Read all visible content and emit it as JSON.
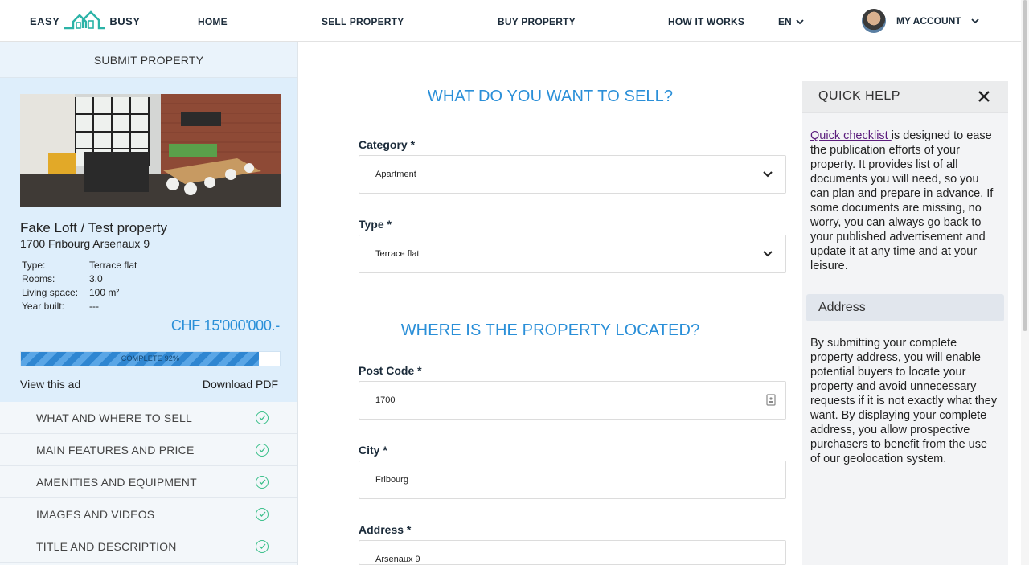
{
  "nav": {
    "logo_left": "EASY",
    "logo_right": "BUSY",
    "home": "HOME",
    "sell": "SELL PROPERTY",
    "buy": "BUY PROPERTY",
    "how": "HOW IT WORKS",
    "lang": "EN",
    "account": "MY ACCOUNT"
  },
  "sidebar": {
    "title": "SUBMIT PROPERTY",
    "property": {
      "name": "Fake Loft / Test property",
      "address": "1700 Fribourg Arsenaux 9",
      "specs": [
        {
          "label": "Type:",
          "value": "Terrace flat"
        },
        {
          "label": "Rooms:",
          "value": "3.0"
        },
        {
          "label": "Living space:",
          "value": "100 m²"
        },
        {
          "label": "Year built:",
          "value": "---"
        }
      ],
      "price": "CHF 15'000'000.-",
      "progress_text": "COMPLETE 92%",
      "progress_fraction": 0.92,
      "view_link": "View this ad",
      "pdf_link": "Download PDF"
    },
    "steps": [
      {
        "label": "WHAT AND WHERE TO SELL"
      },
      {
        "label": "MAIN FEATURES AND PRICE"
      },
      {
        "label": "AMENITIES AND EQUIPMENT"
      },
      {
        "label": "IMAGES AND VIDEOS"
      },
      {
        "label": "TITLE AND DESCRIPTION"
      }
    ]
  },
  "form": {
    "section1_title": "WHAT DO YOU WANT TO SELL?",
    "category_label": "Category *",
    "category_value": "Apartment",
    "type_label": "Type *",
    "type_value": "Terrace flat",
    "section2_title": "WHERE IS THE PROPERTY LOCATED?",
    "postcode_label": "Post Code *",
    "postcode_value": "1700",
    "city_label": "City *",
    "city_value": "Fribourg",
    "address_label": "Address *",
    "address_value": "Arsenaux 9"
  },
  "help": {
    "title": "QUICK HELP",
    "link": "Quick checklist ",
    "text1": "is designed to ease the publication efforts of your property. It provides list of all documents you will need, so you can plan and prepare in advance. If some documents are missing, no worry, you can always go back to your published advertisement and update it at any time and at your leisure.",
    "sub_title": "Address",
    "text2": "By submitting your complete property address, you will enable potential buyers to locate your property and avoid unnecessary requests if it is not exactly what they want. By displaying your complete address, you allow prospective purchasers to benefit from the use of our geolocation system."
  },
  "colors": {
    "accent": "#2a8fd8",
    "check": "#3cc08b",
    "link": "#5a1c7c"
  }
}
